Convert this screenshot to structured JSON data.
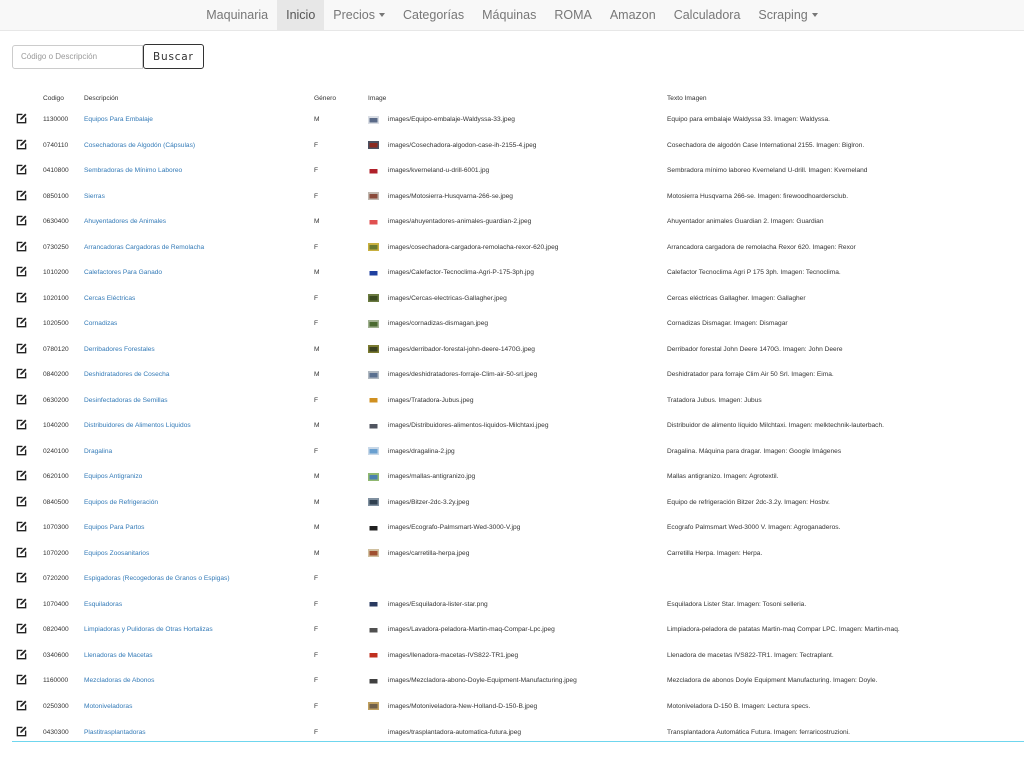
{
  "nav": {
    "items": [
      {
        "label": "Maquinaria",
        "active": false,
        "dropdown": false
      },
      {
        "label": "Inicio",
        "active": true,
        "dropdown": false
      },
      {
        "label": "Precios",
        "active": false,
        "dropdown": true
      },
      {
        "label": "Categorías",
        "active": false,
        "dropdown": false
      },
      {
        "label": "Máquinas",
        "active": false,
        "dropdown": false
      },
      {
        "label": "ROMA",
        "active": false,
        "dropdown": false
      },
      {
        "label": "Amazon",
        "active": false,
        "dropdown": false
      },
      {
        "label": "Calculadora",
        "active": false,
        "dropdown": false
      },
      {
        "label": "Scraping",
        "active": false,
        "dropdown": true
      }
    ]
  },
  "search": {
    "placeholder": "Código o Descripción",
    "value": "",
    "button_label": "Buscar"
  },
  "table": {
    "headers": {
      "codigo": "Codigo",
      "descripcion": "Descripción",
      "genero": "Género",
      "image": "Image",
      "texto": "Texto Imagen"
    },
    "rows": [
      {
        "codigo": "1130000",
        "descripcion": "Equipos Para Embalaje",
        "genero": "M",
        "image": "images/Equipo-embalaje-Waldyssa-33.jpeg",
        "texto": "Equipo para embalaje Waldyssa 33. Imagen: Waldyssa.",
        "thumb": [
          "#5a6a88",
          "#d9dde4"
        ]
      },
      {
        "codigo": "0740110",
        "descripcion": "Cosechadoras de Algodón (Cápsulas)",
        "genero": "F",
        "image": "images/Cosechadora-algodon-case-ih-2155-4.jpeg",
        "texto": "Cosechadora de algodón Case International 2155. Imagen: Biglron.",
        "thumb": [
          "#8a2a20",
          "#4a5060"
        ]
      },
      {
        "codigo": "0410800",
        "descripcion": "Sembradoras de Mínimo Laboreo",
        "genero": "F",
        "image": "images/kverneland-u-drill-6001.jpg",
        "texto": "Sembradora mínimo laboreo Kverneland U-drill. Imagen: Kverneland",
        "thumb": [
          "#b0202a",
          "#ffffff"
        ]
      },
      {
        "codigo": "0850100",
        "descripcion": "Sierras",
        "genero": "F",
        "image": "images/Motosierra-Husqvarna-266-se.jpeg",
        "texto": "Motosierra Husqvarna 266-se. Imagen: firewoodhoardersclub.",
        "thumb": [
          "#8a4a3a",
          "#c0b8b0"
        ]
      },
      {
        "codigo": "0630400",
        "descripcion": "Ahuyentadores de Animales",
        "genero": "M",
        "image": "images/ahuyentadores-animales-guardian-2.jpeg",
        "texto": "Ahuyentador animales Guardian 2. Imagen: Guardian",
        "thumb": [
          "#e05050",
          "#ffffff"
        ]
      },
      {
        "codigo": "0730250",
        "descripcion": "Arrancadoras Cargadoras de Remolacha",
        "genero": "F",
        "image": "images/cosechadora-cargadora-remolacha-rexor-620.jpeg",
        "texto": "Arrancadora cargadora de remolacha Rexor 620. Imagen: Rexor",
        "thumb": [
          "#6a7a30",
          "#c8b040"
        ]
      },
      {
        "codigo": "1010200",
        "descripcion": "Calefactores Para Ganado",
        "genero": "M",
        "image": "images/Calefactor-Tecnoclima-Agri-P-175-3ph.jpg",
        "texto": "Calefactor Tecnoclima Agri P 175 3ph. Imagen: Tecnoclima.",
        "thumb": [
          "#2040a0",
          "#ffffff"
        ]
      },
      {
        "codigo": "1020100",
        "descripcion": "Cercas Eléctricas",
        "genero": "F",
        "image": "images/Cercas-electricas-Gallagher.jpeg",
        "texto": "Cercas eléctricas Gallagher. Imagen: Gallagher",
        "thumb": [
          "#3a4a20",
          "#6a7a40"
        ]
      },
      {
        "codigo": "1020500",
        "descripcion": "Cornadizas",
        "genero": "F",
        "image": "images/cornadizas-dismagan.jpeg",
        "texto": "Cornadizas Dismagar. Imagen: Dismagar",
        "thumb": [
          "#4a6a30",
          "#a0b090"
        ]
      },
      {
        "codigo": "0780120",
        "descripcion": "Derribadores Forestales",
        "genero": "M",
        "image": "images/derribador-forestal-john-deere-1470G.jpeg",
        "texto": "Derribador forestal John Deere 1470G. Imagen: John Deere",
        "thumb": [
          "#3a4020",
          "#7a7a30"
        ]
      },
      {
        "codigo": "0840200",
        "descripcion": "Deshidratadores de Cosecha",
        "genero": "M",
        "image": "images/deshidratadores-forraje-Clim-air-50-srl.jpeg",
        "texto": "Deshidratador para forraje Clim Air 50 Srl. Imagen: Eima.",
        "thumb": [
          "#5a7090",
          "#b0b8c0"
        ]
      },
      {
        "codigo": "0630200",
        "descripcion": "Desinfectadoras de Semillas",
        "genero": "F",
        "image": "images/Tratadora-Jubus.jpeg",
        "texto": "Tratadora Jubus. Imagen: Jubus",
        "thumb": [
          "#d09020",
          "#ffffff"
        ]
      },
      {
        "codigo": "1040200",
        "descripcion": "Distribuidores de Alimentos Líquidos",
        "genero": "M",
        "image": "images/Distribuidores-alimentos-liquidos-Milchtaxi.jpeg",
        "texto": "Distribuidor de alimento líquido Milchtaxi. Imagen: melktechnik-lauterbach.",
        "thumb": [
          "#505560",
          "#ffffff"
        ]
      },
      {
        "codigo": "0240100",
        "descripcion": "Dragalina",
        "genero": "F",
        "image": "images/dragalina-2.jpg",
        "texto": "Dragalina. Máquina para dragar. Imagen: Google Imágenes",
        "thumb": [
          "#6aa0d0",
          "#c8d8e8"
        ]
      },
      {
        "codigo": "0620100",
        "descripcion": "Equipos Antigranizo",
        "genero": "M",
        "image": "images/mallas-antigranizo.jpg",
        "texto": "Mallas antigranizo. Imagen: Agrotextil.",
        "thumb": [
          "#4a80b0",
          "#90b870"
        ]
      },
      {
        "codigo": "0840500",
        "descripcion": "Equipos de Refrigeración",
        "genero": "M",
        "image": "images/Bitzer-2dc-3.2y.jpeg",
        "texto": "Equipo de refrigeración Bitzer 2dc-3.2y. Imagen: Hosbv.",
        "thumb": [
          "#304050",
          "#8090a0"
        ]
      },
      {
        "codigo": "1070300",
        "descripcion": "Equipos Para Partos",
        "genero": "M",
        "image": "images/Ecografo-Palmsmart-Wed-3000-V.jpg",
        "texto": "Ecografo Palmsmart Wed-3000 V. Imagen: Agroganaderos.",
        "thumb": [
          "#202020",
          "#ffffff"
        ]
      },
      {
        "codigo": "1070200",
        "descripcion": "Equipos Zoosanitarios",
        "genero": "M",
        "image": "images/carretilla-herpa.jpeg",
        "texto": "Carretilla Herpa. Imagen: Herpa.",
        "thumb": [
          "#a05030",
          "#d0c0a0"
        ]
      },
      {
        "codigo": "0720200",
        "descripcion": "Espigadoras (Recogedoras de Granos o Espigas)",
        "genero": "F",
        "image": "",
        "texto": "",
        "thumb": null
      },
      {
        "codigo": "1070400",
        "descripcion": "Esquiladoras",
        "genero": "F",
        "image": "images/Esquiladora-lister-star.png",
        "texto": "Esquiladora Lister Star. Imagen: Tosoni selleria.",
        "thumb": [
          "#2a3a60",
          "#ffffff"
        ]
      },
      {
        "codigo": "0820400",
        "descripcion": "Limpiadoras y Pulidoras de Otras Hortalizas",
        "genero": "F",
        "image": "images/Lavadora-peladora-Martin-maq-Compar-Lpc.jpeg",
        "texto": "Limpiadora-peladora de patatas Martin-maq Compar LPC. Imagen: Martin-maq.",
        "thumb": [
          "#505050",
          "#ffffff"
        ]
      },
      {
        "codigo": "0340600",
        "descripcion": "Llenadoras de Macetas",
        "genero": "F",
        "image": "images/llenadora-macetas-IVS822-TR1.jpeg",
        "texto": "Llenadora de macetas IVS822-TR1. Imagen: Tectraplant.",
        "thumb": [
          "#c03020",
          "#ffffff"
        ]
      },
      {
        "codigo": "1160000",
        "descripcion": "Mezcladoras de Abonos",
        "genero": "F",
        "image": "images/Mezcladora-abono-Doyle-Equipment-Manufacturing.jpeg",
        "texto": "Mezcladora de abonos Doyle Equipment Manufacturing. Imagen: Doyle.",
        "thumb": [
          "#404040",
          "#ffffff"
        ]
      },
      {
        "codigo": "0250300",
        "descripcion": "Motoniveladoras",
        "genero": "F",
        "image": "images/Motoniveladora-New-Holland-D-150-B.jpeg",
        "texto": "Motoniveladora D-150 B. Imagen: Lectura specs.",
        "thumb": [
          "#70604a",
          "#c0a060"
        ]
      },
      {
        "codigo": "0430300",
        "descripcion": "Plastitrasplantadoras",
        "genero": "F",
        "image": "images/trasplantadora-automatica-futura.jpeg",
        "texto": "Transplantadora Automática Futura. Imagen: ferraricostruzioni.",
        "thumb": null
      }
    ]
  }
}
